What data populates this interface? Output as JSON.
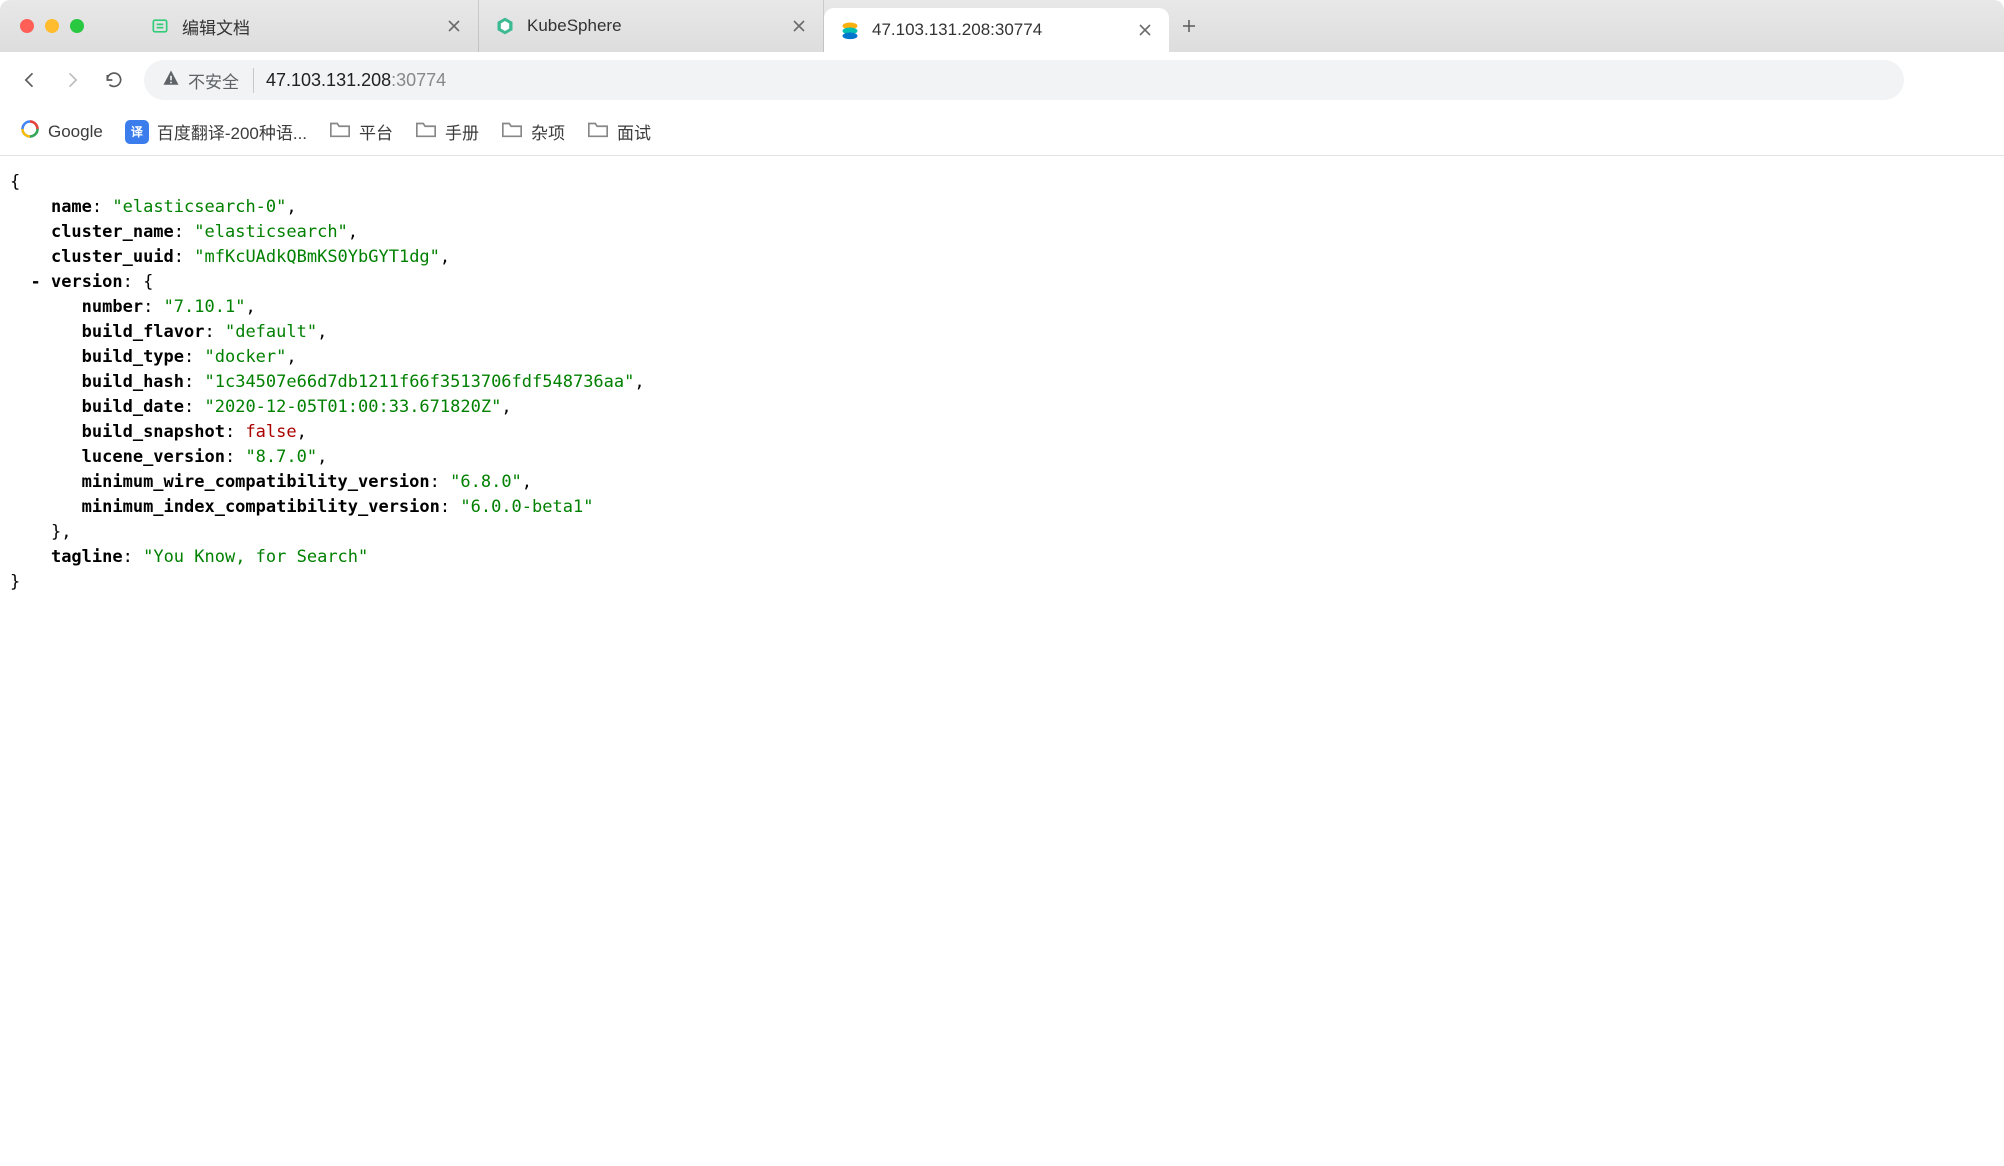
{
  "tabs": [
    {
      "title": "编辑文档",
      "favicon": "yuque"
    },
    {
      "title": "KubeSphere",
      "favicon": "kubesphere"
    },
    {
      "title": "47.103.131.208:30774",
      "favicon": "elastic",
      "active": true
    }
  ],
  "toolbar": {
    "security_label": "不安全",
    "url_host": "47.103.131.208",
    "url_port": ":30774"
  },
  "bookmarks": {
    "google": "Google",
    "translate": "百度翻译-200种语...",
    "folders": [
      "平台",
      "手册",
      "杂项",
      "面试"
    ]
  },
  "json": {
    "name": {
      "key": "name",
      "value": "\"elasticsearch-0\""
    },
    "cluster_name": {
      "key": "cluster_name",
      "value": "\"elasticsearch\""
    },
    "cluster_uuid": {
      "key": "cluster_uuid",
      "value": "\"mfKcUAdkQBmKS0YbGYT1dg\""
    },
    "version_key": "version",
    "version": {
      "number": {
        "key": "number",
        "value": "\"7.10.1\""
      },
      "build_flavor": {
        "key": "build_flavor",
        "value": "\"default\""
      },
      "build_type": {
        "key": "build_type",
        "value": "\"docker\""
      },
      "build_hash": {
        "key": "build_hash",
        "value": "\"1c34507e66d7db1211f66f3513706fdf548736aa\""
      },
      "build_date": {
        "key": "build_date",
        "value": "\"2020-12-05T01:00:33.671820Z\""
      },
      "build_snapshot": {
        "key": "build_snapshot",
        "value": "false",
        "is_bool": true
      },
      "lucene_version": {
        "key": "lucene_version",
        "value": "\"8.7.0\""
      },
      "minimum_wire_compatibility_version": {
        "key": "minimum_wire_compatibility_version",
        "value": "\"6.8.0\""
      },
      "minimum_index_compatibility_version": {
        "key": "minimum_index_compatibility_version",
        "value": "\"6.0.0-beta1\""
      }
    },
    "tagline": {
      "key": "tagline",
      "value": "\"You Know, for Search\""
    }
  },
  "icons": {
    "translate_glyph": "译"
  }
}
